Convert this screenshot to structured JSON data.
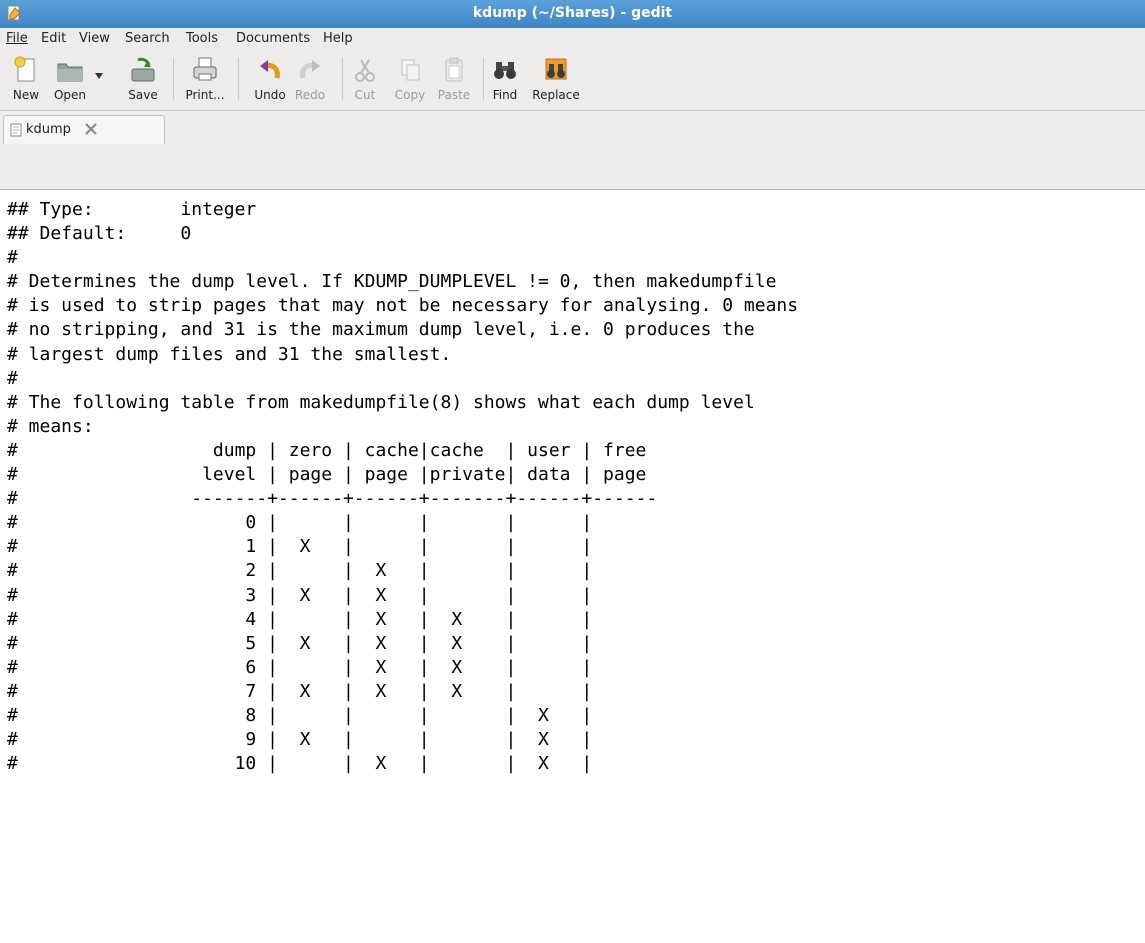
{
  "window": {
    "title": "kdump (~/Shares) - gedit",
    "icon": "gedit-app-icon"
  },
  "menu": [
    {
      "label": "File",
      "mnemonic": "F"
    },
    {
      "label": "Edit",
      "mnemonic": "E"
    },
    {
      "label": "View",
      "mnemonic": "V"
    },
    {
      "label": "Search",
      "mnemonic": "S"
    },
    {
      "label": "Tools",
      "mnemonic": "T"
    },
    {
      "label": "Documents",
      "mnemonic": "D"
    },
    {
      "label": "Help",
      "mnemonic": "H"
    }
  ],
  "toolbar": {
    "new": "New",
    "open": "Open",
    "save": "Save",
    "print": "Print...",
    "undo": "Undo",
    "redo": "Redo",
    "cut": "Cut",
    "copy": "Copy",
    "paste": "Paste",
    "find": "Find",
    "replace": "Replace"
  },
  "tab": {
    "label": "kdump"
  },
  "editor": {
    "lines": [
      "## Type:        integer",
      "## Default:     0",
      "#",
      "# Determines the dump level. If KDUMP_DUMPLEVEL != 0, then makedumpfile",
      "# is used to strip pages that may not be necessary for analysing. 0 means",
      "# no stripping, and 31 is the maximum dump level, i.e. 0 produces the",
      "# largest dump files and 31 the smallest.",
      "#",
      "# The following table from makedumpfile(8) shows what each dump level",
      "# means:",
      "#                  dump | zero | cache|cache  | user | free",
      "#                 level | page | page |private| data | page",
      "#                -------+------+------+-------+------+------",
      "#                     0 |      |      |       |      |",
      "#                     1 |  X   |      |       |      |",
      "#                     2 |      |  X   |       |      |",
      "#                     3 |  X   |  X   |       |      |",
      "#                     4 |      |  X   |  X    |      |",
      "#                     5 |  X   |  X   |  X    |      |",
      "#                     6 |      |  X   |  X    |      |",
      "#                     7 |  X   |  X   |  X    |      |",
      "#                     8 |      |      |       |  X   |",
      "#                     9 |  X   |      |       |  X   |",
      "#                    10 |      |  X   |       |  X   |"
    ]
  }
}
